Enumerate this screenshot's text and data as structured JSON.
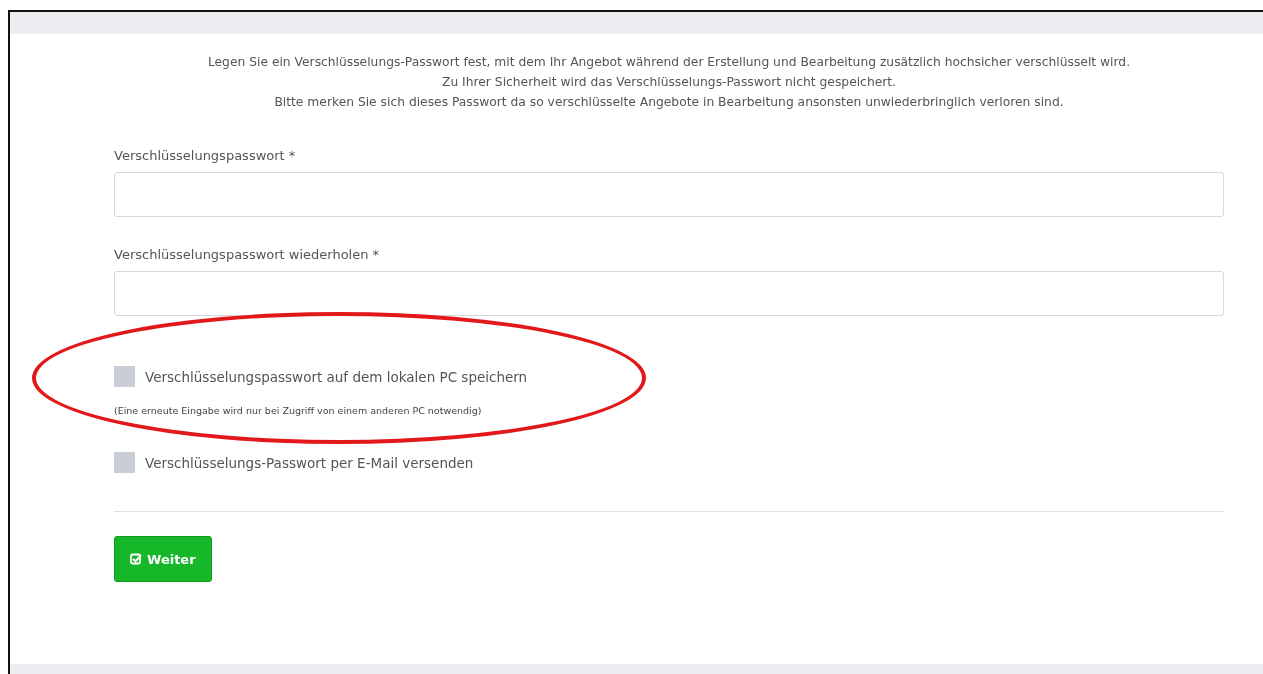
{
  "intro": [
    "Legen Sie ein Verschlüsselungs-Passwort fest, mit dem Ihr Angebot während der Erstellung und Bearbeitung zusätzlich hochsicher verschlüsselt wird.",
    "Zu Ihrer Sicherheit wird das Verschlüsselungs-Passwort nicht gespeichert.",
    "Bitte merken Sie sich dieses Passwort da so verschlüsselte Angebote in Bearbeitung ansonsten unwiederbringlich verloren sind."
  ],
  "fields": [
    {
      "label": "Verschlüsselungspasswort *"
    },
    {
      "label": "Verschlüsselungspasswort wiederholen *"
    }
  ],
  "options": [
    {
      "label": "Verschlüsselungspasswort auf dem lokalen PC speichern",
      "checked": false,
      "note": "(Eine erneute Eingabe wird nur bei Zugriff von einem anderen PC notwendig)",
      "highlighted": true
    },
    {
      "label": "Verschlüsselungs-Passwort per E-Mail versenden",
      "checked": false,
      "highlighted": false
    }
  ],
  "submit": {
    "label": "Weiter"
  }
}
